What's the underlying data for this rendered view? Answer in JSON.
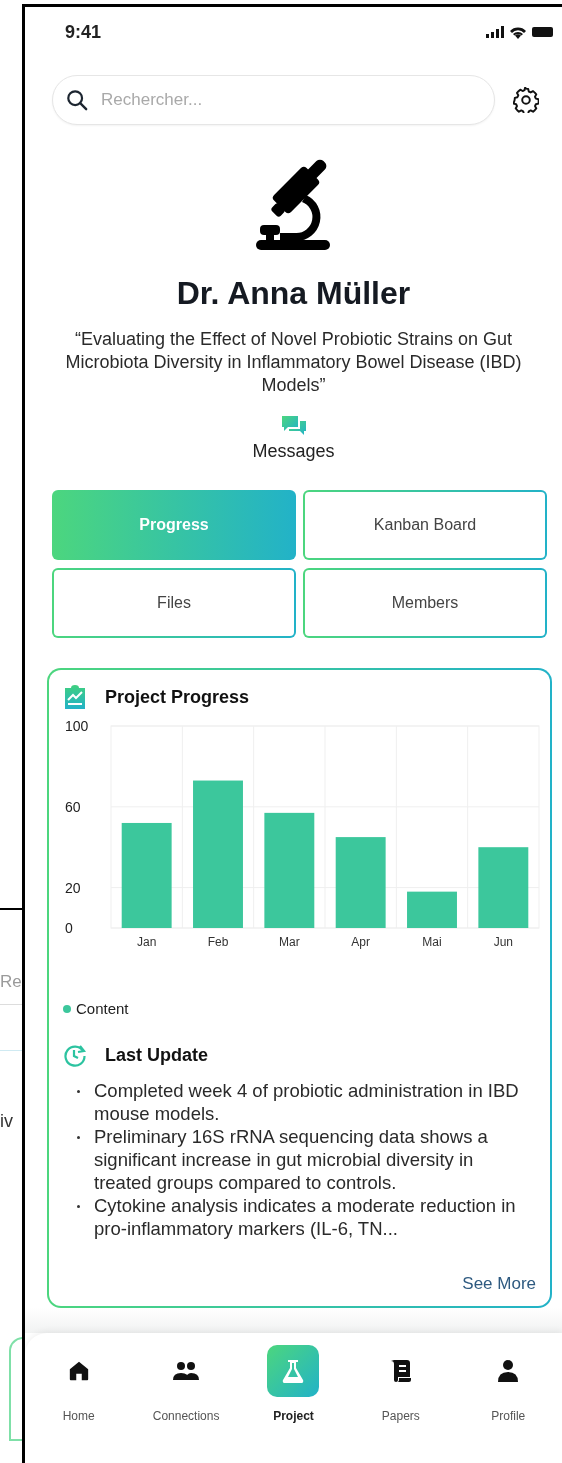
{
  "background_window": {
    "field_text": "Re",
    "text": "iv"
  },
  "status_bar": {
    "time": "9:41"
  },
  "search": {
    "placeholder": "Rechercher..."
  },
  "profile": {
    "name": "Dr. Anna Müller",
    "project_title": "“Evaluating the Effect of Novel Probiotic Strains on Gut Microbiota Diversity in Inflammatory Bowel Disease (IBD) Models”",
    "messages_label": "Messages"
  },
  "tabs": [
    {
      "label": "Progress",
      "selected": true
    },
    {
      "label": "Kanban Board",
      "selected": false
    },
    {
      "label": "Files",
      "selected": false
    },
    {
      "label": "Members",
      "selected": false
    }
  ],
  "progress_card": {
    "title": "Project Progress",
    "chart_data": {
      "type": "bar",
      "categories": [
        "Jan",
        "Feb",
        "Mar",
        "Apr",
        "Mai",
        "Jun"
      ],
      "series": [
        {
          "name": "Content",
          "color": "#3cc79c",
          "values": [
            52,
            73,
            57,
            45,
            18,
            40
          ]
        }
      ],
      "ylim": [
        0,
        100
      ],
      "yticks": [
        0,
        20,
        60,
        100
      ]
    },
    "last_update": {
      "title": "Last Update",
      "items": [
        "Completed week 4 of probiotic administration in IBD mouse models.",
        "Preliminary 16S rRNA sequencing data shows a significant increase in gut microbial diversity in treated groups compared to controls.",
        "Cytokine analysis indicates a moderate reduction in pro-inflammatory markers (IL-6, TN..."
      ]
    },
    "see_more": "See More"
  },
  "nav": [
    {
      "kind": "home",
      "label": "Home",
      "selected": false
    },
    {
      "kind": "connections",
      "label": "Connections",
      "selected": false
    },
    {
      "kind": "project",
      "label": "Project",
      "selected": true
    },
    {
      "kind": "papers",
      "label": "Papers",
      "selected": false
    },
    {
      "kind": "profile",
      "label": "Profile",
      "selected": false
    }
  ]
}
